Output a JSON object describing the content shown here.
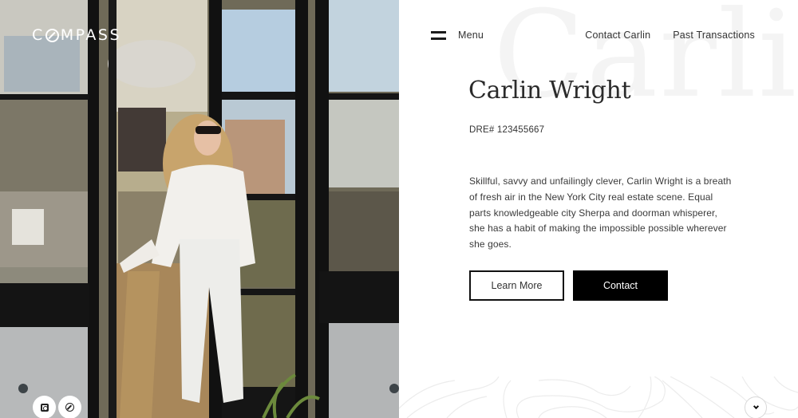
{
  "brand": {
    "logo_text_left": "C",
    "logo_text_right": "MPASS",
    "logo_full": "COMPASS"
  },
  "header": {
    "menu_label": "Menu",
    "nav": [
      {
        "label": "Contact Carlin"
      },
      {
        "label": "Past Transactions"
      }
    ]
  },
  "agent": {
    "watermark": "Carlin",
    "name": "Carlin Wright",
    "license": "DRE# 123455667",
    "bio": "Skillful, savvy and unfailingly clever, Carlin Wright is a breath of fresh air in the New York City real estate scene. Equal parts knowledgeable city Sherpa and doorman whisperer, she has a habit of making the impossible possible wherever she goes."
  },
  "actions": {
    "learn_more": "Learn More",
    "contact": "Contact"
  },
  "social": [
    {
      "icon": "instagram-icon"
    },
    {
      "icon": "compass-icon"
    }
  ],
  "scroll": {
    "icon": "chevron-down-icon"
  },
  "colors": {
    "primary_button_bg": "#000000",
    "primary_button_text": "#ffffff",
    "text": "#2b2b2b",
    "watermark": "#f4f4f4"
  }
}
